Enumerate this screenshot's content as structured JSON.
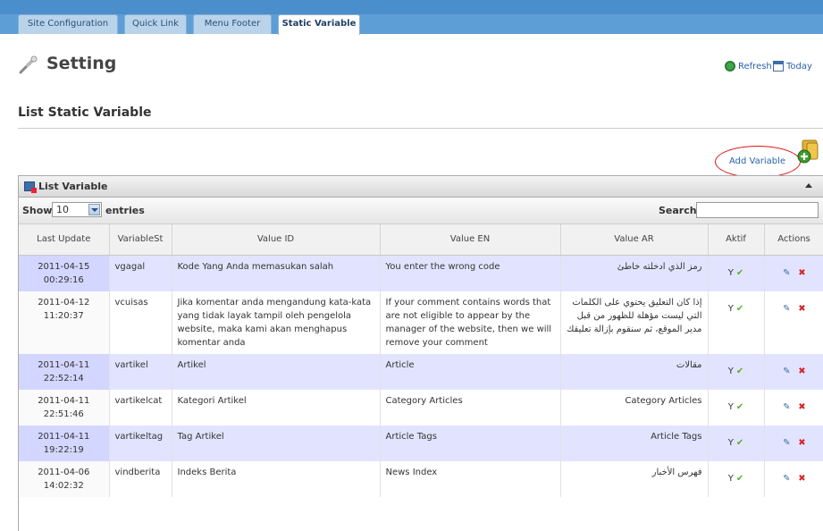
{
  "tabs": [
    {
      "label": "Site Configuration",
      "active": false
    },
    {
      "label": "Quick Link",
      "active": false
    },
    {
      "label": "Menu Footer",
      "active": false
    },
    {
      "label": "Static Variable",
      "active": true
    }
  ],
  "header": {
    "title": "Setting",
    "refresh_label": "Refresh",
    "today_label": "Today"
  },
  "section": {
    "title": "List Static Variable",
    "add_label": "Add Variable"
  },
  "panel": {
    "title": "List Variable",
    "show_label": "Show",
    "entries_value": "10",
    "entries_label": "entries",
    "search_label": "Search:",
    "search_value": ""
  },
  "table": {
    "columns": [
      "Last Update",
      "VariableSt",
      "Value ID",
      "Value EN",
      "Value AR",
      "Aktif",
      "Actions"
    ],
    "rows": [
      {
        "date": "2011-04-15 00:29:16",
        "var": "vgagal",
        "id": "Kode Yang Anda memasukan salah",
        "en": "You enter the wrong code",
        "ar": "رمز الذي ادخلته خاطئ",
        "aktif": "Y"
      },
      {
        "date": "2011-04-12 11:20:37",
        "var": "vcuisas",
        "id": "Jika komentar anda mengandung kata-kata yang tidak layak tampil oleh pengelola website, maka kami akan menghapus komentar anda",
        "en": "If your comment contains words that are not eligible to appear by the manager of the website, then we will remove your comment",
        "ar": "إذا كان التعليق يحتوي على الكلمات التي ليست مؤهلة للظهور من قبل مدير الموقع، ثم سنقوم بإزالة تعليقك",
        "aktif": "Y"
      },
      {
        "date": "2011-04-11 22:52:14",
        "var": "vartikel",
        "id": "Artikel",
        "en": "Article",
        "ar": "مقالات",
        "aktif": "Y"
      },
      {
        "date": "2011-04-11 22:51:46",
        "var": "vartikelcat",
        "id": "Kategori Artikel",
        "en": "Category Articles",
        "ar": "Category Articles",
        "aktif": "Y"
      },
      {
        "date": "2011-04-11 19:22:19",
        "var": "vartikeltag",
        "id": "Tag Artikel",
        "en": "Article Tags",
        "ar": "Article Tags",
        "aktif": "Y"
      },
      {
        "date": "2011-04-06 14:02:32",
        "var": "vindberita",
        "id": "Indeks Berita",
        "en": "News Index",
        "ar": "فهرس الأخبار",
        "aktif": "Y"
      }
    ]
  },
  "colors": {
    "tab_bar": "#5d9ed6",
    "row_odd": "#e2e4ff",
    "delete": "#d4262d",
    "check": "#59b02e"
  }
}
